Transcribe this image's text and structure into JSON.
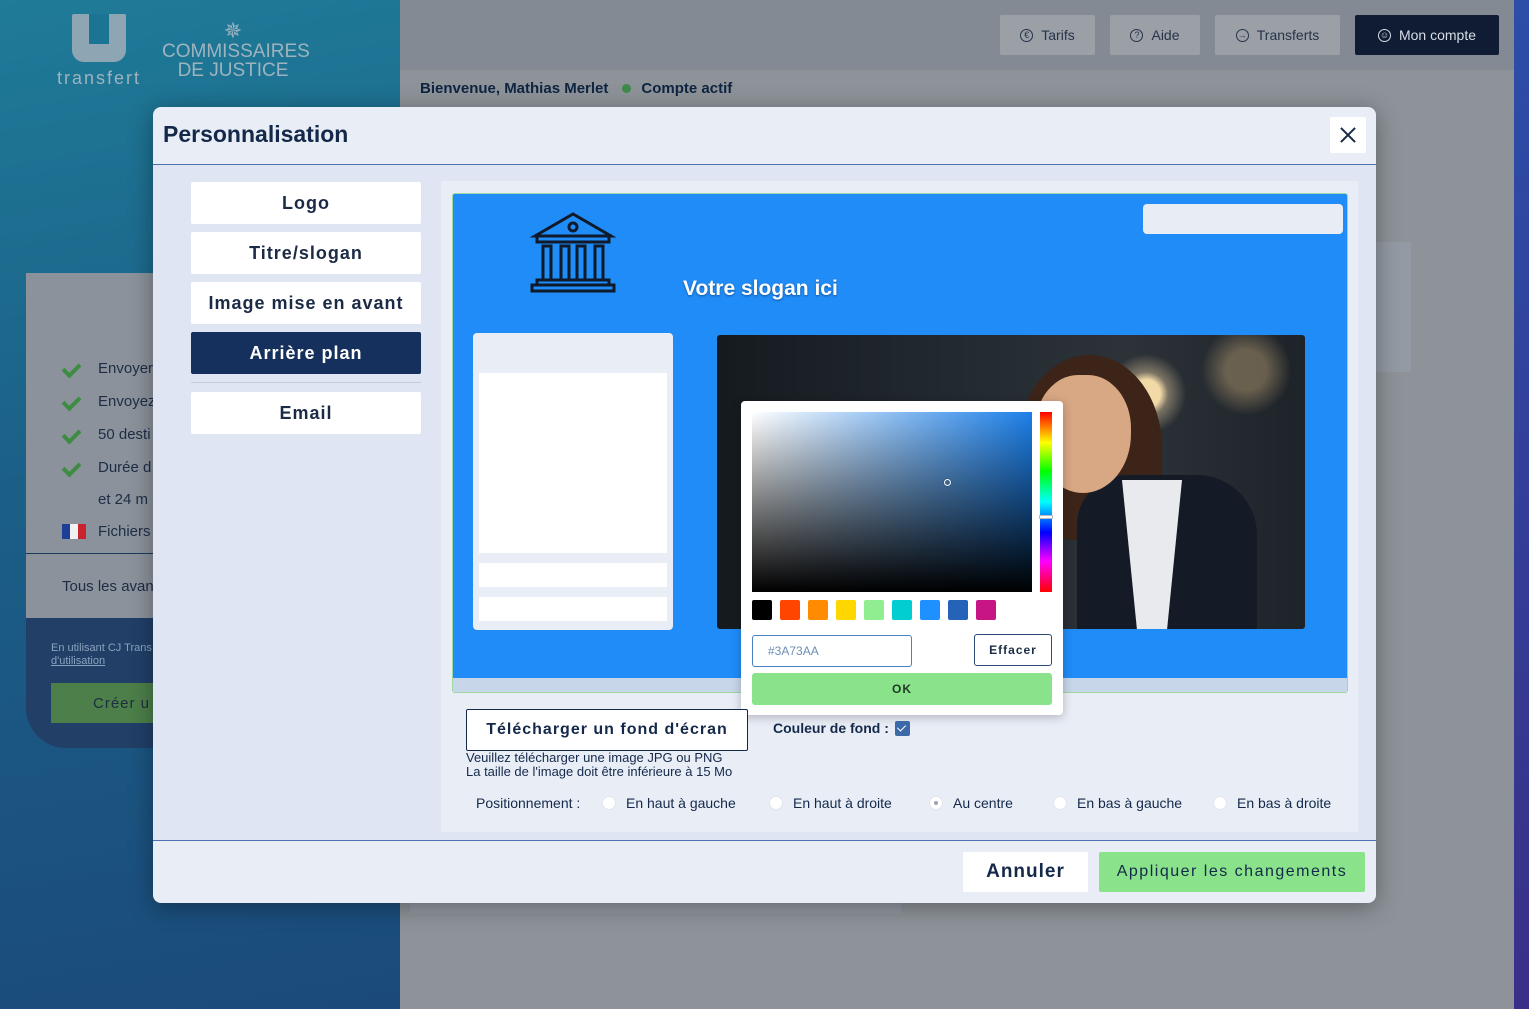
{
  "app": {
    "logo_word": "transfert",
    "brand_line1": "COMMISSAIRES",
    "brand_line2": "DE JUSTICE"
  },
  "header": {
    "buttons": [
      {
        "label": "Tarifs",
        "icon": "euro-icon"
      },
      {
        "label": "Aide",
        "icon": "help-icon"
      },
      {
        "label": "Transferts",
        "icon": "transfer-icon"
      },
      {
        "label": "Mon compte",
        "icon": "account-icon"
      }
    ],
    "welcome": "Bienvenue, Mathias Merlet",
    "status": "Compte actif"
  },
  "background_card": {
    "features": [
      "Envoyer",
      "Envoyez",
      "50 desti",
      "Durée d",
      "et 24 m",
      "Fichiers"
    ],
    "all_features_link": "Tous les avan",
    "terms_text": "En utilisant CJ Trans",
    "terms_link": "d'utilisation",
    "create_button": "Créer u"
  },
  "modal": {
    "title": "Personnalisation",
    "tabs": [
      {
        "label": "Logo",
        "active": false
      },
      {
        "label": "Titre/slogan",
        "active": false
      },
      {
        "label": "Image mise en avant",
        "active": false
      },
      {
        "label": "Arrière plan",
        "active": true
      },
      {
        "label": "Email",
        "active": false
      }
    ],
    "preview": {
      "slogan": "Votre slogan ici",
      "background_color": "#208cf8"
    },
    "color_picker": {
      "hex_value": "#3A73AA",
      "swatches": [
        "#000000",
        "#ff4500",
        "#ff8c00",
        "#ffd700",
        "#90ee90",
        "#00ced1",
        "#1e90ff",
        "#2563b8",
        "#c71585"
      ],
      "clear_label": "Effacer",
      "ok_label": "OK"
    },
    "upload_button": "Télécharger un fond d'écran",
    "upload_hint_1": "Veuillez télécharger une image JPG ou PNG",
    "upload_hint_2": "La taille de l'image doit être inférieure à 15 Mo",
    "bg_color_label": "Couleur de fond :",
    "bg_color_checked": true,
    "positioning_label": "Positionnement :",
    "positions": [
      {
        "label": "En haut à gauche",
        "selected": false
      },
      {
        "label": "En haut à droite",
        "selected": false
      },
      {
        "label": "Au centre",
        "selected": true
      },
      {
        "label": "En bas à gauche",
        "selected": false
      },
      {
        "label": "En bas à droite",
        "selected": false
      }
    ],
    "cancel_label": "Annuler",
    "apply_label": "Appliquer les changements",
    "accent_color": "#15305c",
    "apply_color": "#8ae38a"
  }
}
